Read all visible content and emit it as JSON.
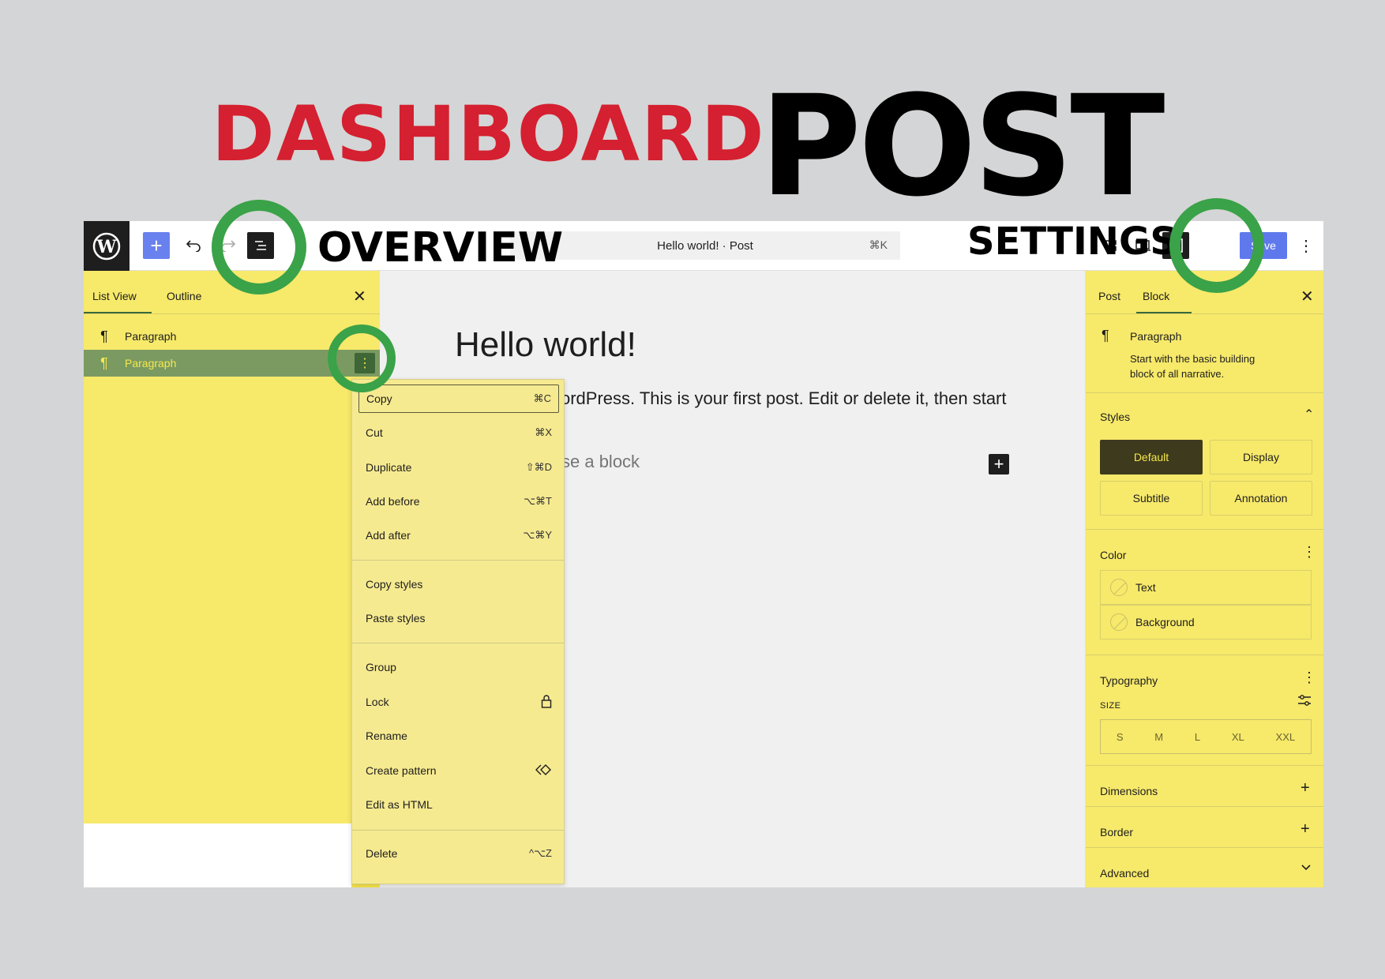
{
  "banner": {
    "title_red": "DASHBOARD",
    "title_black": "POST",
    "callout_overview": "OVERVIEW",
    "callout_settings": "SETTINGS"
  },
  "colors": {
    "accent_red": "#d42030",
    "highlight_yellow": "#f7e96a",
    "ring_green": "#3aa248",
    "wp_blue": "#3858e9"
  },
  "topbar": {
    "logo_icon": "wordpress-logo",
    "inserter_label": "+",
    "command_text": "Hello world! · Post",
    "command_kbd": "⌘K",
    "save_label": "Save",
    "more_label": "⋮"
  },
  "list_view": {
    "tabs": [
      "List View",
      "Outline"
    ],
    "close": "✕",
    "items": [
      "Paragraph",
      "Paragraph"
    ]
  },
  "context_menu": {
    "group1": [
      {
        "label": "Copy",
        "kbd": "⌘C"
      },
      {
        "label": "Cut",
        "kbd": "⌘X"
      },
      {
        "label": "Duplicate",
        "kbd": "⇧⌘D"
      },
      {
        "label": "Add before",
        "kbd": "⌥⌘T"
      },
      {
        "label": "Add after",
        "kbd": "⌥⌘Y"
      }
    ],
    "group2": [
      {
        "label": "Copy styles"
      },
      {
        "label": "Paste styles"
      }
    ],
    "group3": [
      {
        "label": "Group"
      },
      {
        "label": "Lock",
        "icon": "lock-icon"
      },
      {
        "label": "Rename"
      },
      {
        "label": "Create pattern",
        "icon": "pattern-icon"
      },
      {
        "label": "Edit as HTML"
      }
    ],
    "group4": [
      {
        "label": "Delete",
        "kbd": "^⌥Z"
      }
    ]
  },
  "editor": {
    "title": "Hello world!",
    "body": "ordPress. This is your first post. Edit or delete it, then start",
    "placeholder": "se a block"
  },
  "settings": {
    "tabs": [
      "Post",
      "Block"
    ],
    "close": "✕",
    "block_name": "Paragraph",
    "block_desc_1": "Start with the basic building",
    "block_desc_2": "block of all narrative.",
    "styles_label": "Styles",
    "styles": [
      "Default",
      "Display",
      "Subtitle",
      "Annotation"
    ],
    "color_label": "Color",
    "color_items": [
      "Text",
      "Background"
    ],
    "typography_label": "Typography",
    "size_label": "SIZE",
    "sizes": [
      "S",
      "M",
      "L",
      "XL",
      "XXL"
    ],
    "dimensions_label": "Dimensions",
    "border_label": "Border",
    "advanced_label": "Advanced"
  }
}
